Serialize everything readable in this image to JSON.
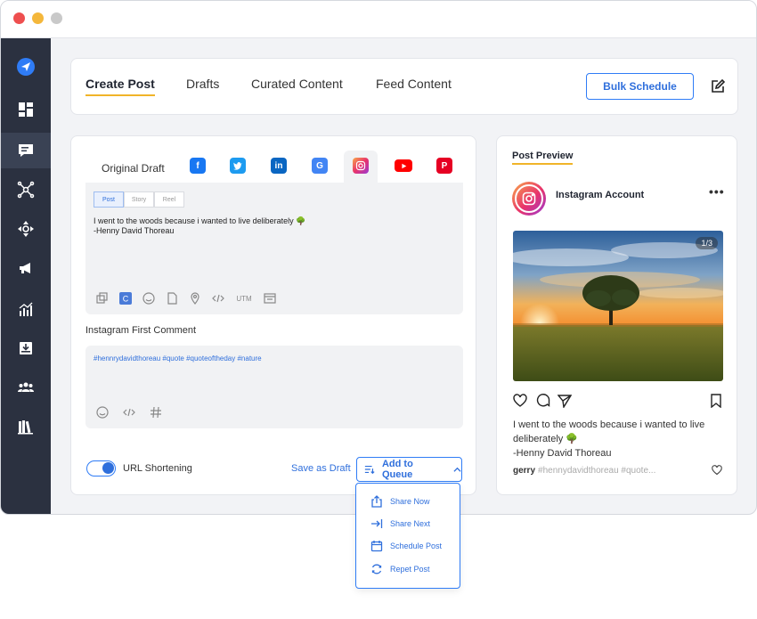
{
  "nav": {
    "tabs": [
      {
        "label": "Create Post"
      },
      {
        "label": "Drafts"
      },
      {
        "label": "Curated Content"
      },
      {
        "label": "Feed Content"
      }
    ],
    "bulk_schedule_label": "Bulk Schedule"
  },
  "composer": {
    "original_draft_label": "Original Draft",
    "networks": [
      "facebook-icon",
      "twitter-icon",
      "linkedin-icon",
      "google-business-icon",
      "instagram-icon",
      "youtube-icon",
      "pinterest-icon"
    ],
    "active_network": "instagram",
    "post_types": [
      "Post",
      "Story",
      "Reel"
    ],
    "post_text": "I went to the woods because i wanted to live deliberately 🌳\n-Henny David Thoreau",
    "utm_label": "UTM",
    "first_comment_label": "Instagram First Comment",
    "first_comment_text": "#hennrydavidthoreau #quote #quoteoftheday #nature",
    "url_shortening_label": "URL Shortening",
    "url_shortening_on": true,
    "save_draft_label": "Save as Draft",
    "add_to_queue_label": "Add to Queue"
  },
  "queue_menu": {
    "items": [
      {
        "label": "Share Now",
        "icon": "share-icon"
      },
      {
        "label": "Share Next",
        "icon": "share-next-icon"
      },
      {
        "label": "Schedule Post",
        "icon": "calendar-icon"
      },
      {
        "label": "Repet Post",
        "icon": "repeat-icon"
      }
    ]
  },
  "preview": {
    "title": "Post Preview",
    "account_name": "Instagram Account",
    "image_counter": "1/3",
    "caption_line1": "I went to the woods because i wanted to live deliberately 🌳",
    "caption_line2": "-Henny David Thoreau",
    "comment_user": "gerry",
    "comment_text": "#hennydavidthoreau #quote..."
  },
  "colors": {
    "accent": "#2f6fdc",
    "underline": "#f0b429",
    "sidebar": "#2b3140"
  }
}
